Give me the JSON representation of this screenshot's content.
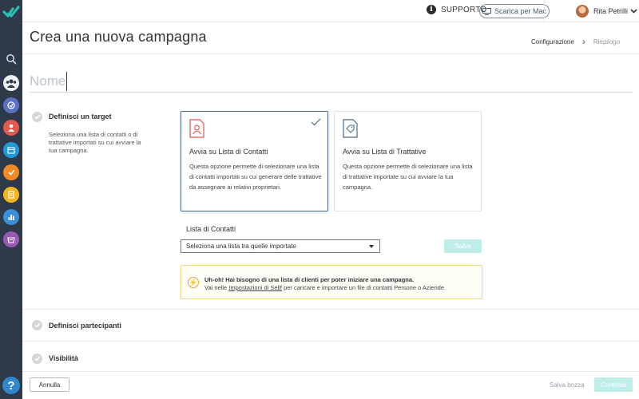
{
  "topbar": {
    "support_label": "SUPPORTO",
    "mac_button_label": "Scarica per Mac",
    "user_name": "Rita Petrilli"
  },
  "header": {
    "title": "Crea una nuova campagna",
    "steps": [
      "Configurazione",
      "Riepilogo"
    ]
  },
  "name_field": {
    "placeholder": "Nome",
    "value": ""
  },
  "target": {
    "title": "Definisci un target",
    "description": "Seleziona una lista di contatti o di trattative importati su cui avviare la tua campagna.",
    "cards": [
      {
        "title": "Avvia su Lista di Contatti",
        "description": "Questa opzione permette di selezionare una lista di contatti importati su cui generare delle trattative da assegnare ai relativi proprietari.",
        "selected": true
      },
      {
        "title": "Avvia su Lista di Trattative",
        "description": "Questa opzione permette di selezionare una lista di trattative importate su cui avviare la tua campagna.",
        "selected": false
      }
    ],
    "list_label": "Lista di Contatti",
    "select_placeholder": "Seleziona una lista tra quelle importate",
    "save_label": "Salva",
    "warning": {
      "title": "Uh-oh! Hai bisogno di una lista di clienti per poter iniziare una campagna.",
      "text_before": "Vai nelle ",
      "link": "Impostazioni di Sellf",
      "text_after": " per caricare e importare un file di contatti Persone o Aziende."
    }
  },
  "sections": {
    "participants": "Definisci partecipanti",
    "visibility": "Visibilità"
  },
  "footer": {
    "cancel_label": "Annulla",
    "draft_label": "Salva bozza",
    "continue_label": "Continua"
  },
  "colors": {
    "sidebar_bg": "#2e3a49",
    "accent_teal": "#bfeee8",
    "selected_border": "#4e6a84",
    "warning_border": "#f6d37f",
    "logo_teal": "#2bbfb0"
  }
}
